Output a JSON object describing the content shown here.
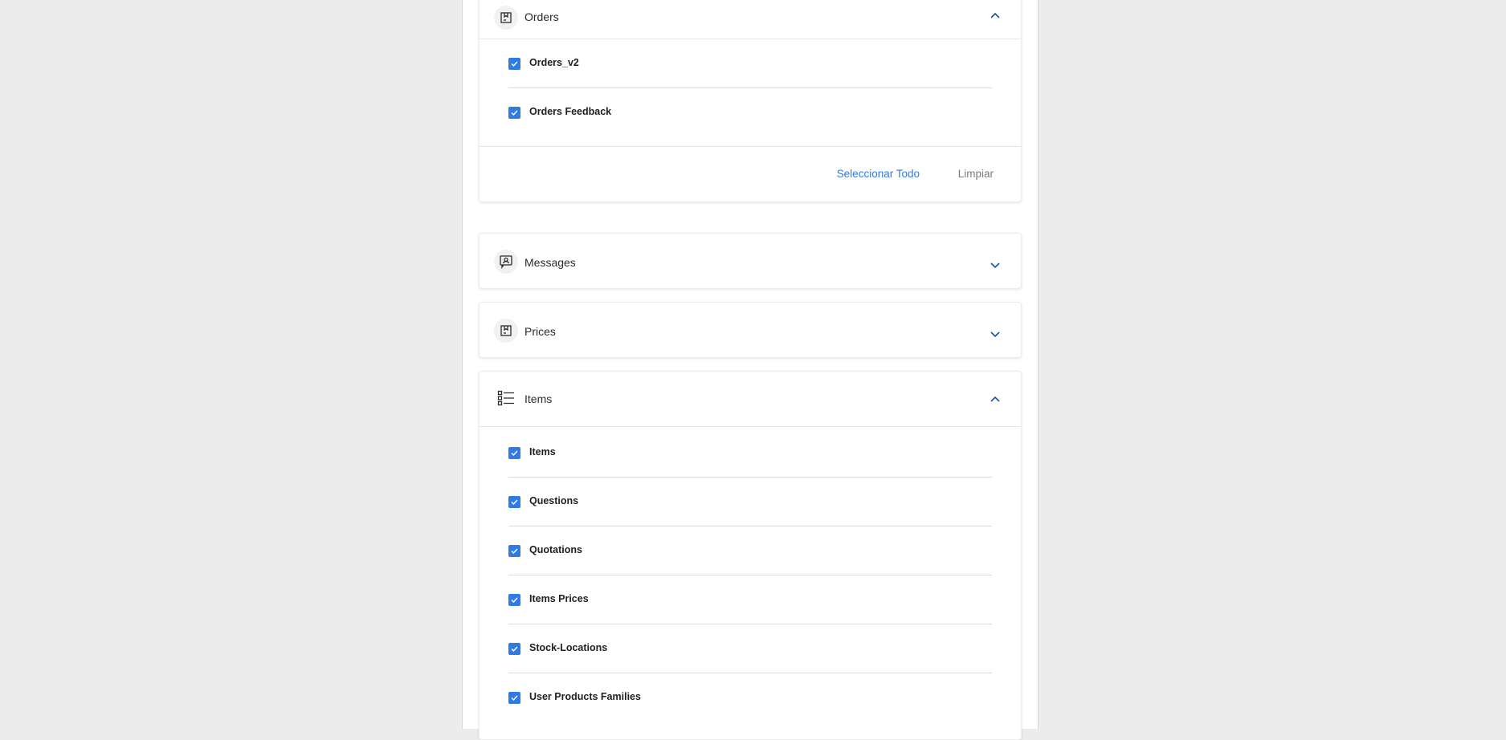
{
  "sections": {
    "orders": {
      "title": "Orders",
      "icon": "box-icon",
      "expanded": true,
      "items": [
        {
          "label": "Orders_v2",
          "checked": true
        },
        {
          "label": "Orders Feedback",
          "checked": true
        }
      ],
      "footer": {
        "select_all": "Seleccionar Todo",
        "clear": "Limpiar"
      }
    },
    "messages": {
      "title": "Messages",
      "icon": "message-user-icon",
      "expanded": false
    },
    "prices": {
      "title": "Prices",
      "icon": "box-icon",
      "expanded": false
    },
    "items": {
      "title": "Items",
      "icon": "list-icon",
      "expanded": true,
      "items": [
        {
          "label": "Items",
          "checked": true
        },
        {
          "label": "Questions",
          "checked": true
        },
        {
          "label": "Quotations",
          "checked": true
        },
        {
          "label": "Items Prices",
          "checked": true
        },
        {
          "label": "Stock-Locations",
          "checked": true
        },
        {
          "label": "User Products Families",
          "checked": true
        }
      ]
    }
  },
  "colors": {
    "accent": "#2f7ae5",
    "chevron": "#1f4fa8",
    "muted": "#7a7a7a"
  }
}
